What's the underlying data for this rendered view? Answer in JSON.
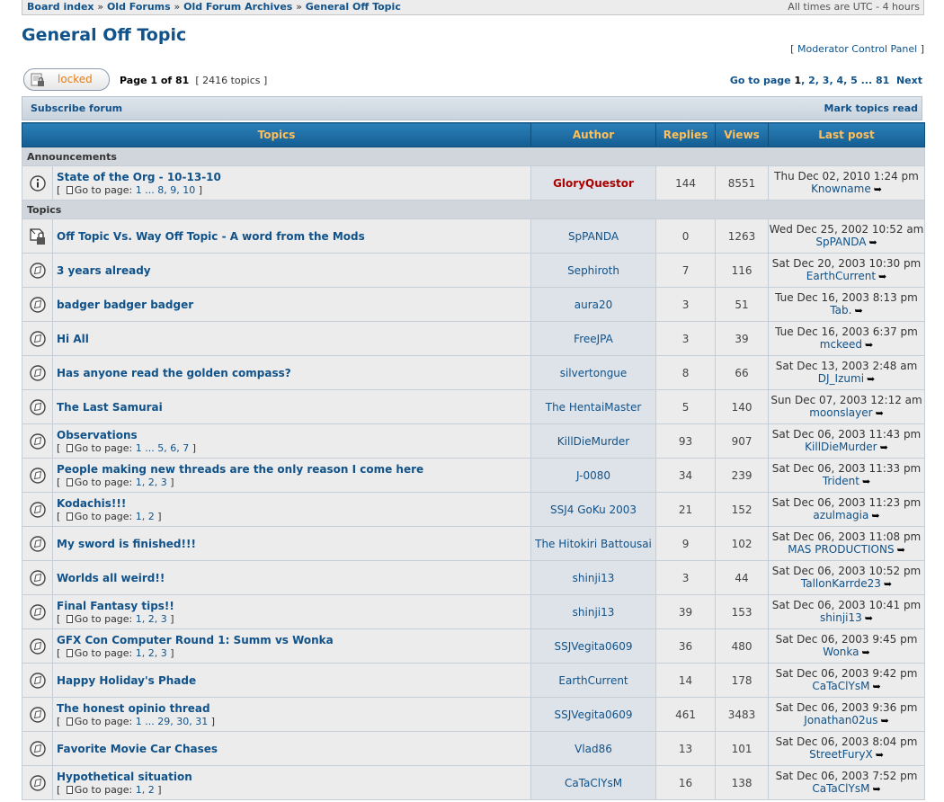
{
  "breadcrumb": {
    "items": [
      "Board index",
      "Old Forums",
      "Old Forum Archives",
      "General Off Topic"
    ],
    "separator": "»",
    "timezone": "All times are UTC - 4 hours"
  },
  "forum_title": "General Off Topic",
  "mcp_label": "Moderator Control Panel",
  "locked_button": {
    "label": "locked"
  },
  "pagination": {
    "page_label": "Page 1 of 81",
    "topics_count": "[ 2416 topics ]",
    "goto_label": "Go to page",
    "pages": [
      "1",
      "2",
      "3",
      "4",
      "5",
      "81"
    ],
    "next_label": "Next"
  },
  "actions": {
    "subscribe": "Subscribe forum",
    "mark_read": "Mark topics read"
  },
  "columns": {
    "topics": "Topics",
    "author": "Author",
    "replies": "Replies",
    "views": "Views",
    "last_post": "Last post"
  },
  "sections": {
    "announcements": "Announcements",
    "topics": "Topics"
  },
  "goto_page_text": "Go to page:",
  "announcements": [
    {
      "title": "State of the Org - 10-13-10",
      "pages": "1 ... 8, 9, 10",
      "author": "GloryQuestor",
      "author_admin": true,
      "replies": "144",
      "views": "8551",
      "last_date": "Thu Dec 02, 2010 1:24 pm",
      "last_user": "Knowname",
      "icon": "announcement-icon"
    }
  ],
  "topics": [
    {
      "title": "Off Topic Vs. Way Off Topic - A word from the Mods",
      "pages": "",
      "author": "SpPANDA",
      "replies": "0",
      "views": "1263",
      "last_date": "Wed Dec 25, 2002 10:52 am",
      "last_user": "SpPANDA",
      "icon": "sticky-locked-icon"
    },
    {
      "title": "3 years already",
      "pages": "",
      "author": "Sephiroth",
      "replies": "7",
      "views": "116",
      "last_date": "Sat Dec 20, 2003 10:30 pm",
      "last_user": "EarthCurrent",
      "icon": "topic-read-icon"
    },
    {
      "title": "badger badger badger",
      "pages": "",
      "author": "aura20",
      "replies": "3",
      "views": "51",
      "last_date": "Tue Dec 16, 2003 8:13 pm",
      "last_user": "Tab.",
      "icon": "topic-read-icon"
    },
    {
      "title": "Hi All",
      "pages": "",
      "author": "FreeJPA",
      "replies": "3",
      "views": "39",
      "last_date": "Tue Dec 16, 2003 6:37 pm",
      "last_user": "mckeed",
      "icon": "topic-read-icon"
    },
    {
      "title": "Has anyone read the golden compass?",
      "pages": "",
      "author": "silvertongue",
      "replies": "8",
      "views": "66",
      "last_date": "Sat Dec 13, 2003 2:48 am",
      "last_user": "DJ_Izumi",
      "icon": "topic-read-icon"
    },
    {
      "title": "The Last Samurai",
      "pages": "",
      "author": "The HentaiMaster",
      "replies": "5",
      "views": "140",
      "last_date": "Sun Dec 07, 2003 12:12 am",
      "last_user": "moonslayer",
      "icon": "topic-read-icon"
    },
    {
      "title": "Observations",
      "pages": "1 ... 5, 6, 7",
      "author": "KillDieMurder",
      "replies": "93",
      "views": "907",
      "last_date": "Sat Dec 06, 2003 11:43 pm",
      "last_user": "KillDieMurder",
      "icon": "topic-read-icon"
    },
    {
      "title": "People making new threads are the only reason I come here",
      "pages": "1, 2, 3",
      "author": "J-0080",
      "replies": "34",
      "views": "239",
      "last_date": "Sat Dec 06, 2003 11:33 pm",
      "last_user": "Trident",
      "icon": "topic-read-icon"
    },
    {
      "title": "Kodachis!!!",
      "pages": "1, 2",
      "author": "SSJ4 GoKu 2003",
      "replies": "21",
      "views": "152",
      "last_date": "Sat Dec 06, 2003 11:23 pm",
      "last_user": "azulmagia",
      "icon": "topic-read-icon"
    },
    {
      "title": "My sword is finished!!!",
      "pages": "",
      "author": "The Hitokiri Battousai",
      "replies": "9",
      "views": "102",
      "last_date": "Sat Dec 06, 2003 11:08 pm",
      "last_user": "MAS PRODUCTIONS",
      "icon": "topic-read-icon"
    },
    {
      "title": "Worlds all weird!!",
      "pages": "",
      "author": "shinji13",
      "replies": "3",
      "views": "44",
      "last_date": "Sat Dec 06, 2003 10:52 pm",
      "last_user": "TallonKarrde23",
      "icon": "topic-read-icon"
    },
    {
      "title": "Final Fantasy tips!!",
      "pages": "1, 2, 3",
      "author": "shinji13",
      "replies": "39",
      "views": "153",
      "last_date": "Sat Dec 06, 2003 10:41 pm",
      "last_user": "shinji13",
      "icon": "topic-read-icon"
    },
    {
      "title": "GFX Con Computer Round 1: Summ vs Wonka",
      "pages": "1, 2, 3",
      "author": "SSJVegita0609",
      "replies": "36",
      "views": "480",
      "last_date": "Sat Dec 06, 2003 9:45 pm",
      "last_user": "Wonka",
      "icon": "topic-read-icon"
    },
    {
      "title": "Happy Holiday's Phade",
      "pages": "",
      "author": "EarthCurrent",
      "replies": "14",
      "views": "178",
      "last_date": "Sat Dec 06, 2003 9:42 pm",
      "last_user": "CaTaClYsM",
      "icon": "topic-read-icon"
    },
    {
      "title": "The honest opinio thread",
      "pages": "1 ... 29, 30, 31",
      "author": "SSJVegita0609",
      "replies": "461",
      "views": "3483",
      "last_date": "Sat Dec 06, 2003 9:36 pm",
      "last_user": "Jonathan02us",
      "icon": "topic-read-icon"
    },
    {
      "title": "Favorite Movie Car Chases",
      "pages": "",
      "author": "Vlad86",
      "replies": "13",
      "views": "101",
      "last_date": "Sat Dec 06, 2003 8:04 pm",
      "last_user": "StreetFuryX",
      "icon": "topic-read-icon"
    },
    {
      "title": "Hypothetical situation",
      "pages": "1, 2",
      "author": "CaTaClYsM",
      "replies": "16",
      "views": "138",
      "last_date": "Sat Dec 06, 2003 7:52 pm",
      "last_user": "CaTaClYsM",
      "icon": "topic-read-icon"
    }
  ]
}
